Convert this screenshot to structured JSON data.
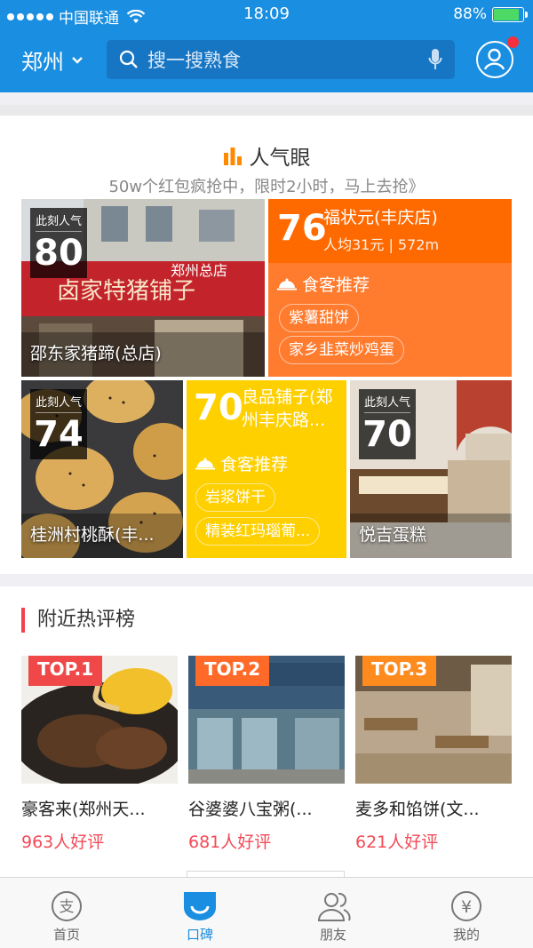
{
  "status_bar": {
    "carrier": "中国联通",
    "time": "18:09",
    "battery": "88%",
    "battery_level": 0.88
  },
  "header": {
    "city": "郑州",
    "search_placeholder": "搜一搜熟食",
    "icons": [
      "chevron-down-icon",
      "search-icon",
      "microphone-icon",
      "user-icon"
    ]
  },
  "popularity": {
    "title": "人气眼",
    "subtitle": "50w个红包疯抢中，限时2小时，马上去抢》",
    "badge_label": "此刻人气",
    "cards": [
      {
        "score": "80",
        "name": "邵东家猪蹄(总店)"
      },
      {
        "score": "74",
        "name": "桂洲村桃酥(丰..."
      },
      {
        "score": "70",
        "name": "悦吉蛋糕"
      }
    ],
    "featured": [
      {
        "score": "76",
        "shop": "福状元(丰庆店)",
        "meta": "人均31元 | 572m",
        "rec_label": "食客推荐",
        "tags": [
          "紫薯甜饼",
          "家乡韭菜炒鸡蛋"
        ],
        "color_top": "#ff6a00",
        "color_bottom": "#ff7b2e"
      },
      {
        "score": "70",
        "shop_line1": "良品铺子(郑",
        "shop_line2": "州丰庆路...",
        "rec_label": "食客推荐",
        "tags": [
          "岩浆饼干",
          "精装红玛瑙葡..."
        ],
        "color": "#ffd000"
      }
    ]
  },
  "nearby": {
    "title": "附近热评榜",
    "items": [
      {
        "rank": "TOP.1",
        "name": "豪客来(郑州天...",
        "reviews": "963人好评",
        "tag_color": "#f04848"
      },
      {
        "rank": "TOP.2",
        "name": "谷婆婆八宝粥(...",
        "reviews": "681人好评",
        "tag_color": "#ff6a28"
      },
      {
        "rank": "TOP.3",
        "name": "麦多和馅饼(文...",
        "reviews": "621人好评",
        "tag_color": "#ff8a1e"
      }
    ]
  },
  "tabbar": {
    "tabs": [
      {
        "label": "首页",
        "icon": "alipay-icon"
      },
      {
        "label": "口碑",
        "icon": "koubei-icon",
        "active": true
      },
      {
        "label": "朋友",
        "icon": "friends-icon"
      },
      {
        "label": "我的",
        "icon": "wallet-icon"
      }
    ]
  },
  "colors": {
    "brand_blue": "#1a8ee0",
    "review_red": "#f24a57"
  }
}
